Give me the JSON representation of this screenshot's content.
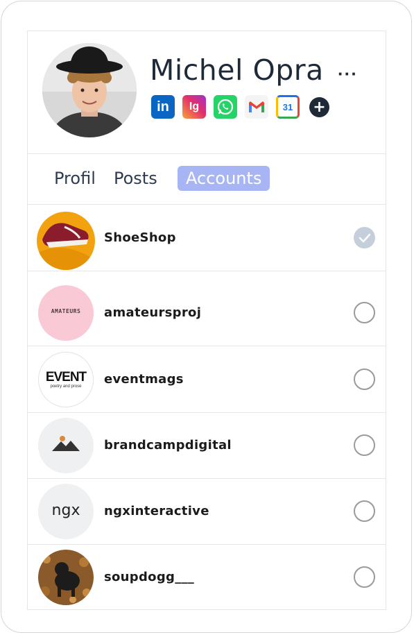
{
  "profile": {
    "name": "Michel Opra",
    "more_label": "···",
    "socials": [
      {
        "icon": "linkedin-icon",
        "label": "in",
        "color": "#0a66c2"
      },
      {
        "icon": "instagram-icon",
        "label": "Ig",
        "color": "#e1306c"
      },
      {
        "icon": "whatsapp-icon",
        "label": "",
        "color": "#25d366"
      },
      {
        "icon": "gmail-icon",
        "label": "M",
        "color": "#ea4335"
      },
      {
        "icon": "calendar-icon",
        "label": "31",
        "color": "#4285f4"
      },
      {
        "icon": "add-icon",
        "label": "+",
        "color": "#1f2a38"
      }
    ]
  },
  "tabs": [
    {
      "label": "Profil",
      "active": false
    },
    {
      "label": "Posts",
      "active": false
    },
    {
      "label": "Accounts",
      "active": true
    }
  ],
  "accounts": [
    {
      "name": "ShoeShop",
      "checked": true,
      "avatar": "shoe-image"
    },
    {
      "name": "amateursproj",
      "checked": false,
      "avatar": "amateurs-logo",
      "logo_text": "AMATEURS"
    },
    {
      "name": "eventmags",
      "checked": false,
      "avatar": "event-logo",
      "logo_text": "EVENT",
      "logo_subtext": "poetry and prose"
    },
    {
      "name": "brandcampdigital",
      "checked": false,
      "avatar": "mountain-logo"
    },
    {
      "name": "ngxinteractive",
      "checked": false,
      "avatar": "ngx-logo",
      "logo_text": "ngx"
    },
    {
      "name": "soupdogg___",
      "checked": false,
      "avatar": "dog-image"
    }
  ],
  "colors": {
    "accent": "#a7b5f5",
    "text_dark": "#1f2a38",
    "check_fill": "#c5cfdc"
  }
}
